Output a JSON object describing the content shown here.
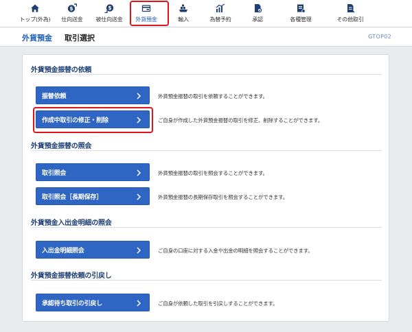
{
  "nav": {
    "items": [
      {
        "label": "トップ(外為)",
        "icon": "home-icon"
      },
      {
        "label": "仕向送金",
        "icon": "remittance-out-icon"
      },
      {
        "label": "被仕向送金",
        "icon": "remittance-in-icon"
      },
      {
        "label": "外貨預金",
        "icon": "foreign-deposit-icon"
      },
      {
        "label": "輸入",
        "icon": "import-icon"
      },
      {
        "label": "為替予約",
        "icon": "exchange-contract-icon"
      },
      {
        "label": "承認",
        "icon": "approval-icon"
      },
      {
        "label": "各種管理",
        "icon": "management-icon"
      },
      {
        "label": "その他取引",
        "icon": "other-transactions-icon"
      }
    ],
    "active_index": 3,
    "accent": "#1f5db8",
    "highlight_color": "#e0121c"
  },
  "header": {
    "section": "外貨預金",
    "page": "取引選択",
    "screen_id": "GTOP02"
  },
  "sections": [
    {
      "title": "外貨預金振替の依頼",
      "actions": [
        {
          "label": "振替依頼",
          "desc": "外貨預金振替の取引を依頼することができます。"
        },
        {
          "label": "作成中取引の修正・削除",
          "desc": "ご自身が作成した外貨預金振替の取引を修正、削除することができます。"
        }
      ]
    },
    {
      "title": "外貨預金振替の照会",
      "actions": [
        {
          "label": "取引照会",
          "desc": "外貨預金振替の取引を照会することができます。"
        },
        {
          "label": "取引照会［長期保存］",
          "desc": "外貨預金振替の長期保存取引を照会することができます。"
        }
      ]
    },
    {
      "title": "外貨預金入出金明細の照会",
      "actions": [
        {
          "label": "入出金明細照会",
          "desc": "ご自身の口座に対する入金や出金の明細を照会することができます。"
        }
      ]
    },
    {
      "title": "外貨預金振替依頼の引戻し",
      "actions": [
        {
          "label": "承認待ち取引の引戻し",
          "desc": "ご自身が依頼した取引を引戻しすることができます。"
        }
      ]
    }
  ]
}
